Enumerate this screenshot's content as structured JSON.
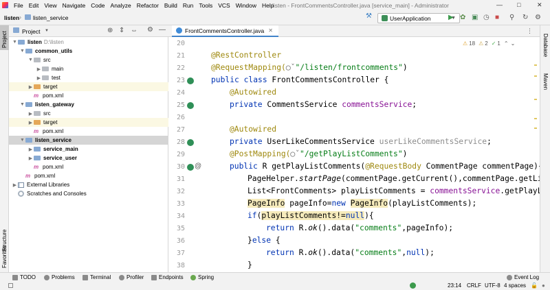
{
  "menu": {
    "items": [
      "File",
      "Edit",
      "View",
      "Navigate",
      "Code",
      "Analyze",
      "Refactor",
      "Build",
      "Run",
      "Tools",
      "VCS",
      "Window",
      "Help"
    ],
    "window_title": "listen - FrontCommentsController.java [service_main] - Administrator"
  },
  "navbar": {
    "crumbs": [
      "listen",
      "listen_service"
    ],
    "run_config": "UserApplication"
  },
  "left_stripe": {
    "project": "Project",
    "structure": "Structure",
    "favorites": "Favorites"
  },
  "right_stripe": {
    "database": "Database",
    "maven": "Maven"
  },
  "project_panel": {
    "title": "Project",
    "tree": [
      {
        "label": "listen",
        "hint": "D:\\listen"
      },
      {
        "label": "common_utils"
      },
      {
        "label": "src"
      },
      {
        "label": "main"
      },
      {
        "label": "test"
      },
      {
        "label": "target"
      },
      {
        "label": "pom.xml"
      },
      {
        "label": "listen_gateway"
      },
      {
        "label": "src"
      },
      {
        "label": "target"
      },
      {
        "label": "pom.xml"
      },
      {
        "label": "listen_service"
      },
      {
        "label": "service_main"
      },
      {
        "label": "service_user"
      },
      {
        "label": "pom.xml"
      },
      {
        "label": "pom.xml"
      },
      {
        "label": "External Libraries"
      },
      {
        "label": "Scratches and Consoles"
      }
    ]
  },
  "editor": {
    "tab": "FrontCommentsController.java",
    "inspection": {
      "warnings": "18",
      "weak": "2",
      "typos": "1"
    },
    "line_numbers": [
      "20",
      "21",
      "22",
      "23",
      "24",
      "25",
      "26",
      "27",
      "28",
      "29",
      "30",
      "31",
      "32",
      "33",
      "34",
      "35",
      "36",
      "37",
      "38"
    ],
    "code": {
      "l21": "@RestController",
      "l22a": "@RequestMapping(",
      "l22b": "\"/listen/frontcomments\"",
      "l22c": ")",
      "l23a": "public class ",
      "l23b": "FrontCommentsController {",
      "l24": "@Autowired",
      "l25a": "private ",
      "l25b": "CommentsService ",
      "l25c": "commentsService",
      "l25d": ";",
      "l27": "@Autowired",
      "l28a": "private ",
      "l28b": "UserLikeCommentsService ",
      "l28c": "userLikeCommentsService",
      "l28d": ";",
      "l29a": "@PostMapping(",
      "l29b": "\"/getPlayListComments\"",
      "l29c": ")",
      "l30a": "public ",
      "l30b": "R getPlayListComments(",
      "l30c": "@RequestBody",
      "l30d": " CommentPage commentPage){",
      "l31a": "PageHelper.",
      "l31b": "startPage",
      "l31c": "(commentPage.getCurrent(),commentPage.getLim",
      "l32a": "List<FrontComments> playListComments = ",
      "l32b": "commentsService",
      "l32c": ".getPlayLi",
      "l33a": "PageInfo",
      "l33b": " pageInfo=",
      "l33c": "new ",
      "l33d": "PageInfo",
      "l33e": "(playListComments);",
      "l34a": "if",
      "l34b": "(",
      "l34c": "playListComments!=",
      "l34d": "null",
      "l34e": "){",
      "l35a": "return ",
      "l35b": "R.",
      "l35c": "ok",
      "l35d": "().data(",
      "l35e": "\"comments\"",
      "l35f": ",pageInfo);",
      "l36a": "}",
      "l36b": "else ",
      "l36c": "{",
      "l37a": "return ",
      "l37b": "R.",
      "l37c": "ok",
      "l37d": "().data(",
      "l37e": "\"comments\"",
      "l37f": ",",
      "l37g": "null",
      "l37h": ");",
      "l38": "}"
    }
  },
  "bottom_tools": [
    "TODO",
    "Problems",
    "Terminal",
    "Profiler",
    "Endpoints",
    "Spring"
  ],
  "event_log": "Event Log",
  "status": {
    "position": "23:14",
    "line_sep": "CRLF",
    "encoding": "UTF-8",
    "indent": "4 spaces"
  },
  "colors": {
    "keyword": "#0033b3",
    "annotation": "#9e880d",
    "string": "#067d17",
    "field": "#871094",
    "gutter_icon": "#2f8f57"
  }
}
